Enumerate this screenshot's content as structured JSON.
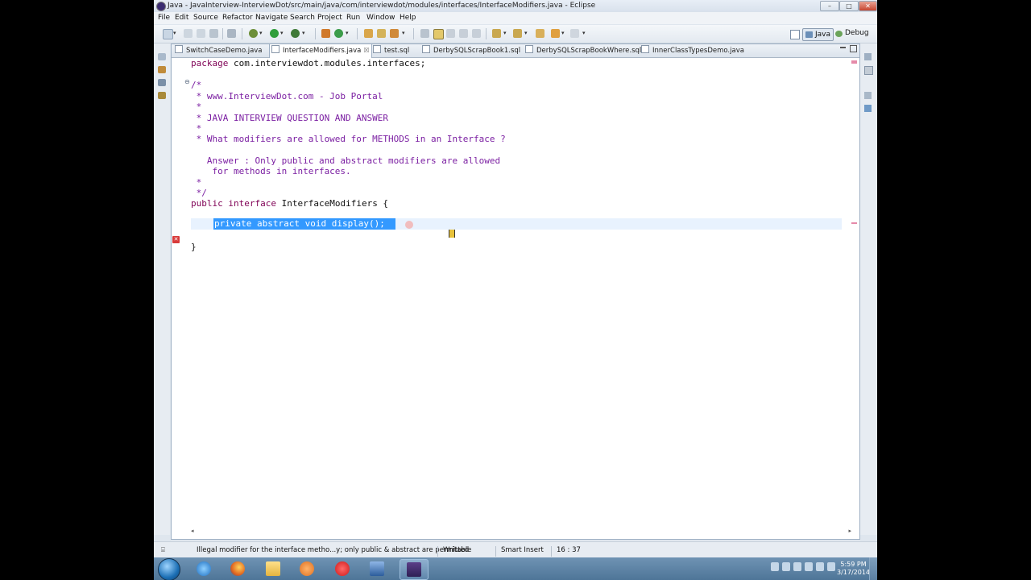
{
  "window": {
    "title": "Java - JavaInterview-InterviewDot/src/main/java/com/interviewdot/modules/interfaces/InterfaceModifiers.java - Eclipse",
    "minimize_glyph": "–",
    "maximize_glyph": "□",
    "close_glyph": "✕"
  },
  "menubar": [
    "File",
    "Edit",
    "Source",
    "Refactor",
    "Navigate",
    "Search",
    "Project",
    "Run",
    "Window",
    "Help"
  ],
  "perspectives": {
    "java": "Java",
    "debug": "Debug"
  },
  "tabs": [
    {
      "label": "SwitchCaseDemo.java"
    },
    {
      "label": "InterfaceModifiers.java",
      "close": "☒"
    },
    {
      "label": "test.sql"
    },
    {
      "label": "DerbySQLScrapBook1.sql"
    },
    {
      "label": "DerbySQLScrapBookWhere.sql"
    },
    {
      "label": "InnerClassTypesDemo.java"
    }
  ],
  "code": {
    "l1_kw": "package",
    "l1_rest": " com.interviewdot.modules.interfaces;",
    "l2": "/*",
    "l3": " * www.InterviewDot.com - Job Portal",
    "l4": " *",
    "l5": " * JAVA INTERVIEW QUESTION AND ANSWER",
    "l6": " *",
    "l7": " * What modifiers are allowed for METHODS in an Interface ?",
    "l8": "   Answer : Only public and abstract modifiers are allowed",
    "l9": "    for methods in interfaces.",
    "l10": " *",
    "l11": " */",
    "l12_kw1": "public",
    "l12_kw2": "interface",
    "l12_rest": " InterfaceModifiers {",
    "l13": "private abstract void display();",
    "l14": "}"
  },
  "status": {
    "message": "Illegal modifier for the interface metho...y; only public & abstract are permitted",
    "writable": "Writable",
    "insert_mode": "Smart Insert",
    "position": "16 : 37"
  },
  "taskbar": {
    "time": "5:59 PM",
    "date": "3/17/2014"
  },
  "colors": {
    "keyword": "#7f0055",
    "comment": "#7b1fa2",
    "selection": "#3399ff",
    "current_line": "#e8f2fe"
  }
}
